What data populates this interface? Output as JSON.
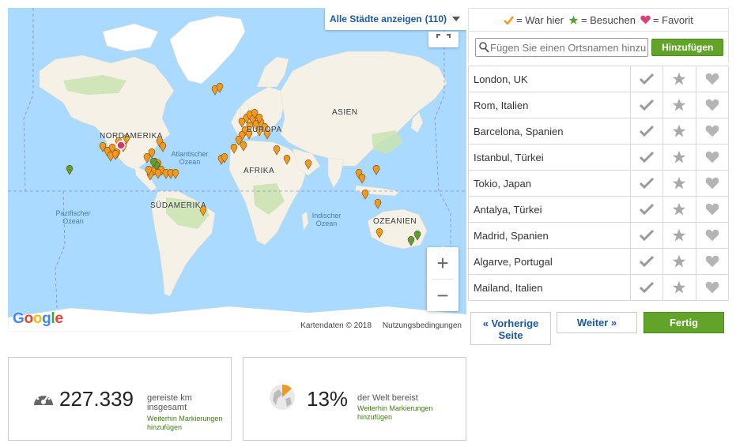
{
  "map": {
    "toggle_label": "Alle Städte anzeigen",
    "toggle_count": "(110)",
    "zoom_in": "+",
    "zoom_out": "−",
    "attribution": "Kartendaten © 2018",
    "terms": "Nutzungsbedingungen",
    "logo": [
      "G",
      "o",
      "o",
      "g",
      "l",
      "e"
    ],
    "labels": {
      "north_america": "NORDAMERIKA",
      "south_america": "SÜDAMERIKA",
      "europe": "EUROPA",
      "africa": "AFRIKA",
      "asia": "ASIEN",
      "oceania": "OZEANIEN",
      "atlantic": "Atlantischer Ozean",
      "pacific": "Pazifischer Ozean",
      "indian": "Indischer Ozean"
    },
    "colors": {
      "water": "#aadaff",
      "land": "#f5f1e6",
      "green": "#c9e4b0",
      "ice": "#ffffff",
      "marker_orange": "#f39a1e",
      "marker_green": "#5aa032",
      "marker_red": "#d6336c"
    }
  },
  "legend": {
    "visited": "= War hier",
    "want": "= Besuchen",
    "favorite": "= Favorit",
    "colors": {
      "check": "#f39a1e",
      "star": "#5aa032",
      "heart": "#e0407a"
    }
  },
  "search": {
    "placeholder": "Fügen Sie einen Ortsnamen hinzu",
    "add_label": "Hinzufügen"
  },
  "cities": [
    "London, UK",
    "Rom, Italien",
    "Barcelona, Spanien",
    "Istanbul, Türkei",
    "Tokio, Japan",
    "Antalya, Türkei",
    "Madrid, Spanien",
    "Algarve, Portugal",
    "Mailand, Italien"
  ],
  "pager": {
    "prev_line1": "« Vorherige",
    "prev_line2": "Seite",
    "next": "Weiter »",
    "done": "Fertig"
  },
  "stats": {
    "distance": {
      "value": "227.339",
      "desc_line1": "gereiste km",
      "desc_line2": "insgesamt",
      "more_line1": "Weiterhin Markierungen",
      "more_line2": "hinzufügen"
    },
    "world": {
      "value": "13%",
      "percent_fraction": 0.13,
      "desc_line1": "der Welt bereist",
      "more_line1": "Weiterhin Markierungen",
      "more_line2": "hinzufügen"
    }
  }
}
